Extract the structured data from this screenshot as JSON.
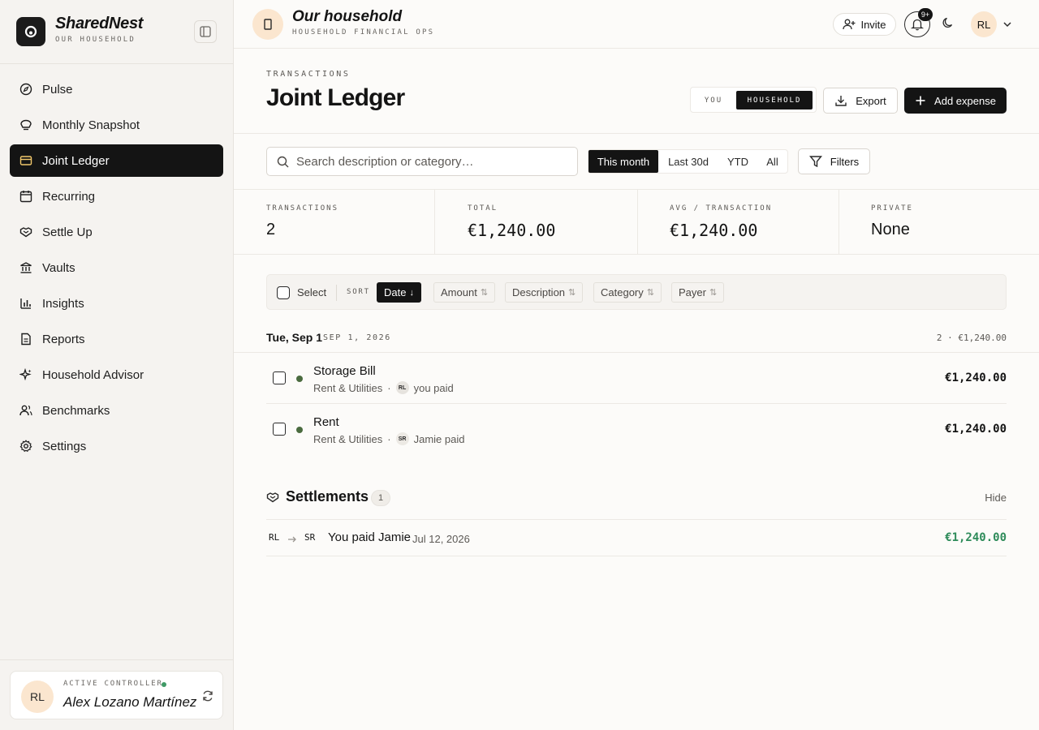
{
  "brand": {
    "name": "SharedNest",
    "subtitle": "OUR HOUSEHOLD"
  },
  "nav": {
    "items": [
      {
        "label": "Pulse",
        "icon": "compass-icon"
      },
      {
        "label": "Monthly Snapshot",
        "icon": "bulb-icon"
      },
      {
        "label": "Joint Ledger",
        "icon": "card-icon",
        "active": true
      },
      {
        "label": "Recurring",
        "icon": "calendar-icon"
      },
      {
        "label": "Settle Up",
        "icon": "handshake-icon"
      },
      {
        "label": "Vaults",
        "icon": "bank-icon"
      },
      {
        "label": "Insights",
        "icon": "bar-chart-icon"
      },
      {
        "label": "Reports",
        "icon": "document-icon"
      },
      {
        "label": "Household Advisor",
        "icon": "sparkles-icon"
      },
      {
        "label": "Benchmarks",
        "icon": "users-icon"
      },
      {
        "label": "Settings",
        "icon": "gear-icon"
      }
    ]
  },
  "user_card": {
    "initials": "RL",
    "label": "ACTIVE CONTROLLER",
    "name": "Alex Lozano Martínez",
    "status_color": "#3f9a66"
  },
  "topbar": {
    "title": "Our household",
    "subtitle": "HOUSEHOLD FINANCIAL OPS",
    "invite_label": "Invite",
    "notification_badge": "9+",
    "avatar_initials": "RL"
  },
  "header": {
    "eyebrow": "TRANSACTIONS",
    "title": "Joint Ledger",
    "scope": {
      "you": "YOU",
      "household": "HOUSEHOLD",
      "selected": "HOUSEHOLD"
    },
    "export_label": "Export",
    "add_label": "Add expense"
  },
  "filters": {
    "search_placeholder": "Search description or category…",
    "ranges": [
      "This month",
      "Last 30d",
      "YTD",
      "All"
    ],
    "selected_range": "This month",
    "filters_label": "Filters"
  },
  "stats": [
    {
      "label": "TRANSACTIONS",
      "value": "2"
    },
    {
      "label": "TOTAL",
      "value": "€1,240.00"
    },
    {
      "label": "AVG / TRANSACTION",
      "value": "€1,240.00"
    },
    {
      "label": "PRIVATE",
      "value": "None"
    }
  ],
  "toolbar": {
    "select_label": "Select",
    "sort_label": "SORT",
    "sort_options": [
      "Date",
      "Amount",
      "Description",
      "Category",
      "Payer"
    ],
    "active_sort": "Date"
  },
  "day_group": {
    "title": "Tue, Sep 1",
    "date": "SEP 1, 2026",
    "summary": "2 · €1,240.00",
    "transactions": [
      {
        "description": "Storage Bill",
        "category": "Rent & Utilities",
        "payer_initials": "RL",
        "payer_text": "you paid",
        "amount": "€1,240.00",
        "dot_color": "#4a6b3f"
      },
      {
        "description": "Rent",
        "category": "Rent & Utilities",
        "payer_initials": "SR",
        "payer_text": "Jamie paid",
        "amount": "€1,240.00",
        "dot_color": "#4a6b3f"
      }
    ]
  },
  "settlements": {
    "title": "Settlements",
    "count": "1",
    "hide_label": "Hide",
    "items": [
      {
        "from": "RL",
        "to": "SR",
        "text": "You paid Jamie",
        "date": "Jul 12, 2026",
        "amount": "€1,240.00",
        "amount_color": "#2e8b5a"
      }
    ]
  }
}
